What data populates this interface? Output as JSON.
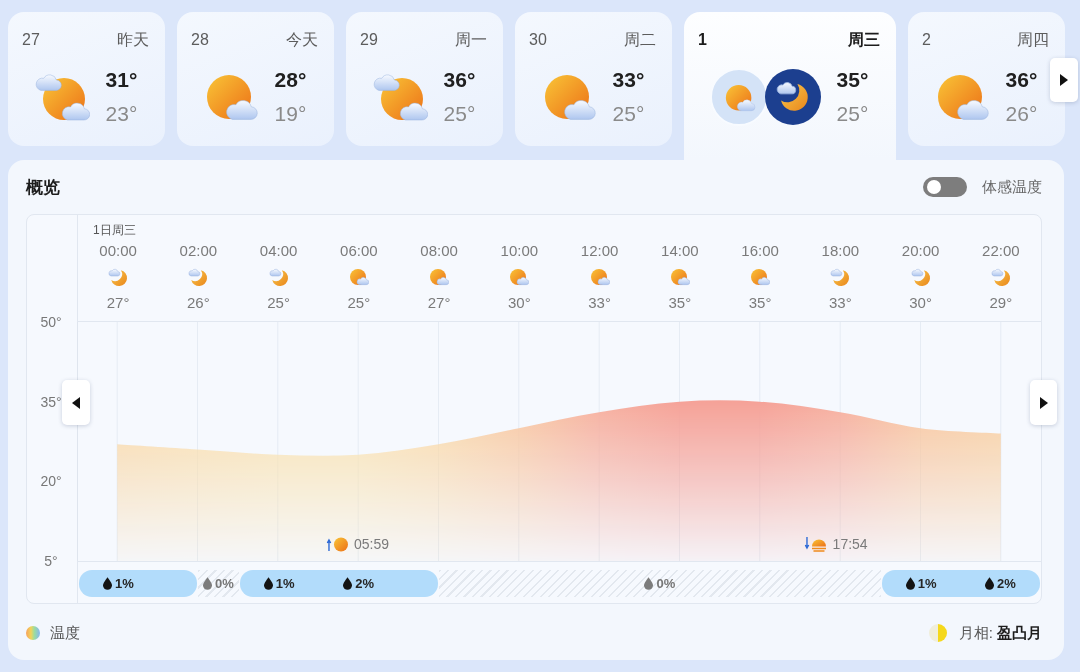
{
  "day_strip": {
    "days": [
      {
        "date": "27",
        "label": "昨天",
        "kind": "cloudy",
        "high": "31°",
        "low": "23°",
        "selected": false
      },
      {
        "date": "28",
        "label": "今天",
        "kind": "partly_cloudy",
        "high": "28°",
        "low": "19°",
        "selected": false
      },
      {
        "date": "29",
        "label": "周一",
        "kind": "cloudy",
        "high": "36°",
        "low": "25°",
        "selected": false
      },
      {
        "date": "30",
        "label": "周二",
        "kind": "partly_cloudy",
        "high": "33°",
        "low": "25°",
        "selected": false
      },
      {
        "date": "1",
        "label": "周三",
        "kind": "partly_cloudy",
        "high": "35°",
        "low": "25°",
        "selected": true
      },
      {
        "date": "2",
        "label": "周四",
        "kind": "partly_cloudy",
        "high": "36°",
        "low": "26°",
        "selected": false
      }
    ]
  },
  "overview": {
    "title": "概览",
    "feels_like": {
      "label": "体感温度",
      "on": false
    },
    "date_label": "1日周三",
    "hours": [
      {
        "kind": "night",
        "temp": "27°"
      },
      {
        "kind": "night",
        "temp": "26°"
      },
      {
        "kind": "night",
        "temp": "25°"
      },
      {
        "kind": "day",
        "temp": "25°"
      },
      {
        "kind": "day",
        "temp": "27°"
      },
      {
        "kind": "day",
        "temp": "30°"
      },
      {
        "kind": "day",
        "temp": "33°"
      },
      {
        "kind": "day",
        "temp": "35°"
      },
      {
        "kind": "day",
        "temp": "35°"
      },
      {
        "kind": "night",
        "temp": "33°"
      },
      {
        "kind": "night",
        "temp": "30°"
      },
      {
        "kind": "night",
        "temp": "29°"
      }
    ],
    "chart_data": [
      {
        "type": "area",
        "categories": [
          "00:00",
          "02:00",
          "04:00",
          "06:00",
          "08:00",
          "10:00",
          "12:00",
          "14:00",
          "16:00",
          "18:00",
          "20:00",
          "22:00"
        ],
        "values": [
          27,
          26,
          25,
          25,
          27,
          30,
          33,
          35,
          35,
          33,
          30,
          29
        ],
        "ylim": [
          5,
          50
        ],
        "yticks": [
          {
            "value": 50,
            "label": "50°"
          },
          {
            "value": 35,
            "label": "35°"
          },
          {
            "value": 20,
            "label": "20°"
          },
          {
            "value": 5,
            "label": "5°"
          }
        ],
        "grid": true
      }
    ],
    "sun_events": [
      {
        "kind": "sunrise",
        "time": "05:59"
      },
      {
        "kind": "sunset",
        "time": "17:54"
      }
    ],
    "precipitation": [
      {
        "kind": "rain",
        "labels": [
          "1%"
        ]
      },
      {
        "kind": "none",
        "labels": [
          "0%"
        ]
      },
      {
        "kind": "rain",
        "labels": [
          "1%",
          "2%"
        ]
      },
      {
        "kind": "none",
        "labels": [
          "0%"
        ]
      },
      {
        "kind": "rain",
        "labels": [
          "1%",
          "2%"
        ]
      }
    ],
    "legend": "温度",
    "moon_phase": "月相: **盈凸月**"
  }
}
